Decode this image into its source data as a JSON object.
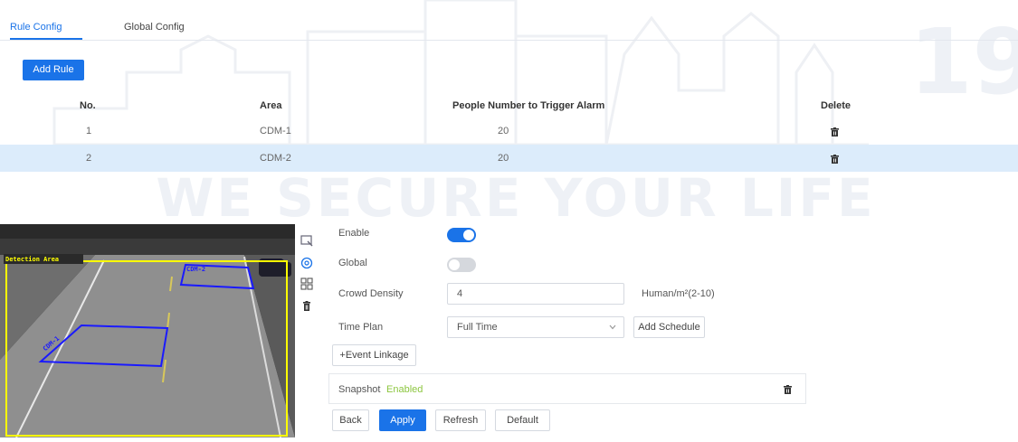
{
  "tabs": {
    "rule_config": "Rule Config",
    "global_config": "Global Config"
  },
  "add_rule_label": "Add Rule",
  "table": {
    "headers": {
      "no": "No.",
      "area": "Area",
      "people": "People Number to Trigger Alarm",
      "delete": "Delete"
    },
    "rows": [
      {
        "no": "1",
        "area": "CDM-1",
        "people": "20"
      },
      {
        "no": "2",
        "area": "CDM-2",
        "people": "20"
      }
    ],
    "selected_row": "2"
  },
  "video": {
    "detection_area_label": "Detection Area",
    "region1_label": "CDM-1",
    "region2_label": "CDM-2"
  },
  "form": {
    "enable_label": "Enable",
    "enable_state": true,
    "global_label": "Global",
    "global_state": false,
    "crowd_density_label": "Crowd Density",
    "crowd_density_value": "4",
    "crowd_density_unit": "Human/m²(2-10)",
    "time_plan_label": "Time Plan",
    "time_plan_value": "Full Time",
    "add_schedule_label": "Add Schedule",
    "event_linkage_label": "+Event Linkage",
    "snapshot_label": "Snapshot",
    "snapshot_status": "Enabled"
  },
  "footer": {
    "back": "Back",
    "apply": "Apply",
    "refresh": "Refresh",
    "default": "Default"
  },
  "watermark": {
    "slogan": "WE SECURE YOUR LIFE",
    "number": "19"
  },
  "colors": {
    "accent": "#1a73e8",
    "selected_row": "#dcecfb",
    "status_enabled": "#8cc63f",
    "region": "#1a1aff",
    "detection_frame": "#ffff00"
  },
  "icons": {
    "tool1": "draw-rule-icon",
    "tool2": "draw-target-icon",
    "tool3": "grid-icon",
    "tool4": "trash-icon"
  }
}
